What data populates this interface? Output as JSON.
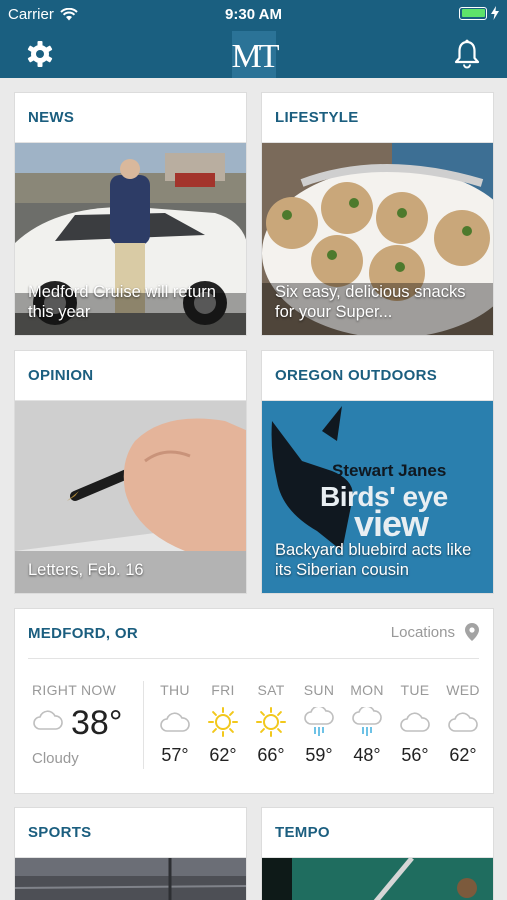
{
  "status": {
    "carrier": "Carrier",
    "time": "9:30 AM",
    "battery_level": 1.0
  },
  "nav": {
    "logo": "MT",
    "settings_icon": "gear-icon",
    "notifications_icon": "bell-icon"
  },
  "colors": {
    "brand": "#1a5f80",
    "section_title": "#1b5e7f",
    "outdoors_bg": "#2a7fae",
    "battery": "#5ee36a",
    "sun": "#f2c81c",
    "rain": "#4ab3e0"
  },
  "cards": {
    "news": {
      "title": "NEWS",
      "caption": "Medford Cruise will return this year"
    },
    "lifestyle": {
      "title": "LIFESTYLE",
      "caption": "Six easy, delicious snacks for your Super..."
    },
    "opinion": {
      "title": "OPINION",
      "caption": "Letters, Feb. 16"
    },
    "outdoors": {
      "title": "OREGON OUTDOORS",
      "caption": "Backyard bluebird acts like its Siberian cousin",
      "art_byline": "Stewart Janes",
      "art_title_1": "Birds' eye",
      "art_title_2": "view"
    },
    "sports": {
      "title": "SPORTS"
    },
    "tempo": {
      "title": "TEMPO"
    }
  },
  "weather": {
    "city": "MEDFORD, OR",
    "locations_label": "Locations",
    "now_label": "RIGHT NOW",
    "now_temp": "38°",
    "now_condition": "Cloudy",
    "now_icon": "cloud-icon",
    "forecast": [
      {
        "day": "THU",
        "temp": "57°",
        "icon": "cloud"
      },
      {
        "day": "FRI",
        "temp": "62°",
        "icon": "sun"
      },
      {
        "day": "SAT",
        "temp": "66°",
        "icon": "sun"
      },
      {
        "day": "SUN",
        "temp": "59°",
        "icon": "rain"
      },
      {
        "day": "MON",
        "temp": "48°",
        "icon": "rain"
      },
      {
        "day": "TUE",
        "temp": "56°",
        "icon": "cloud"
      },
      {
        "day": "WED",
        "temp": "62°",
        "icon": "cloud"
      }
    ]
  }
}
